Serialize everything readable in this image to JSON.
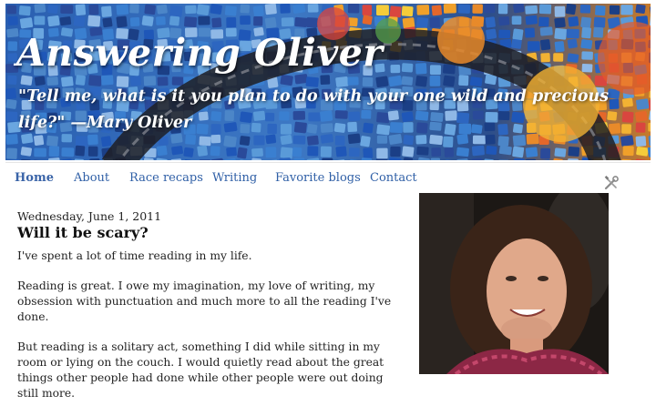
{
  "header": {
    "title": "Answering Oliver",
    "description": "\"Tell me, what is it you plan to do with your one wild and precious life?\" —Mary Oliver"
  },
  "nav": {
    "tabs": [
      {
        "label": "Home"
      },
      {
        "label": "About"
      },
      {
        "label": "Race recaps"
      },
      {
        "label": "Writing"
      },
      {
        "label": "Favorite blogs"
      },
      {
        "label": "Contact"
      }
    ],
    "tools_icon": "wrench-screwdriver-icon"
  },
  "post": {
    "date": "Wednesday, June 1, 2011",
    "title": "Will it be scary?",
    "paragraphs": [
      "I've spent a lot of time reading in my life.",
      "Reading is great. I owe my imagination, my love of writing, my obsession with punctuation and much more to all the reading I've done.",
      "But reading is a solitary act, something I did while sitting in my room or lying on the couch. I would quietly read about the great things other people had done while other people were out doing still more."
    ]
  },
  "sidebar": {
    "profile_photo": "profile-photo"
  },
  "colors": {
    "link": "#2f5fa6",
    "header_bg": "#2c4f8e"
  }
}
